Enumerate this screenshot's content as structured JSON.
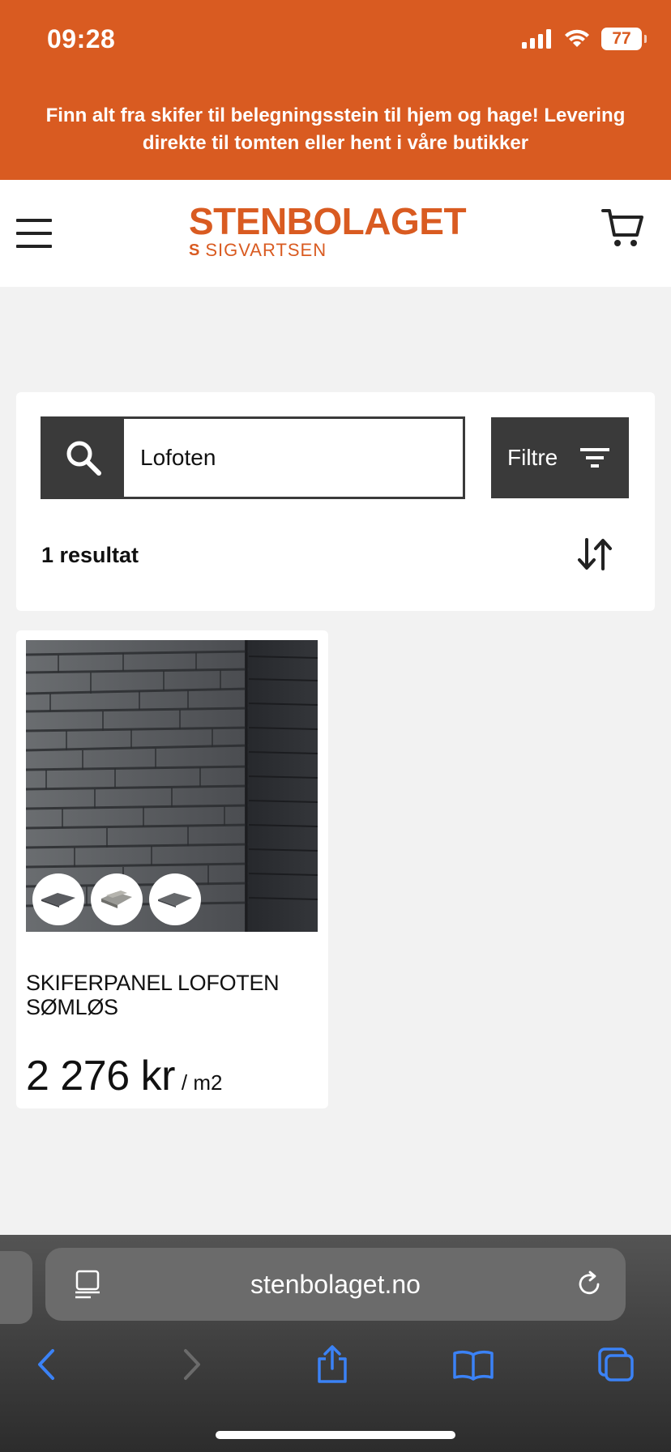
{
  "status_bar": {
    "time": "09:28",
    "battery": "77"
  },
  "promo_banner": {
    "text": "Finn alt fra skifer til belegningsstein til hjem og hage! Levering direkte til tomten eller hent i våre butikker"
  },
  "header": {
    "logo_main": "STENBOLAGET",
    "logo_mark": "S",
    "logo_sub": "SIGVARTSEN"
  },
  "search": {
    "value": "Lofoten",
    "filter_label": "Filtre",
    "result_count": "1 resultat"
  },
  "products": [
    {
      "title": "SKIFERPANEL LOFOTEN SØMLØS",
      "price": "2 276 kr",
      "unit": "/ m2",
      "swatch_count": 3
    }
  ],
  "browser": {
    "url": "stenbolaget.no"
  },
  "colors": {
    "brand": "#d95b21",
    "dark": "#3a3a3a",
    "page_bg": "#f2f2f2"
  },
  "icons": [
    "signal-icon",
    "wifi-icon",
    "battery-icon",
    "hamburger-icon",
    "cart-icon",
    "search-icon",
    "filter-icon",
    "sort-icon",
    "reader-icon",
    "reload-icon",
    "back-icon",
    "forward-icon",
    "share-icon",
    "bookmarks-icon",
    "tabs-icon"
  ]
}
